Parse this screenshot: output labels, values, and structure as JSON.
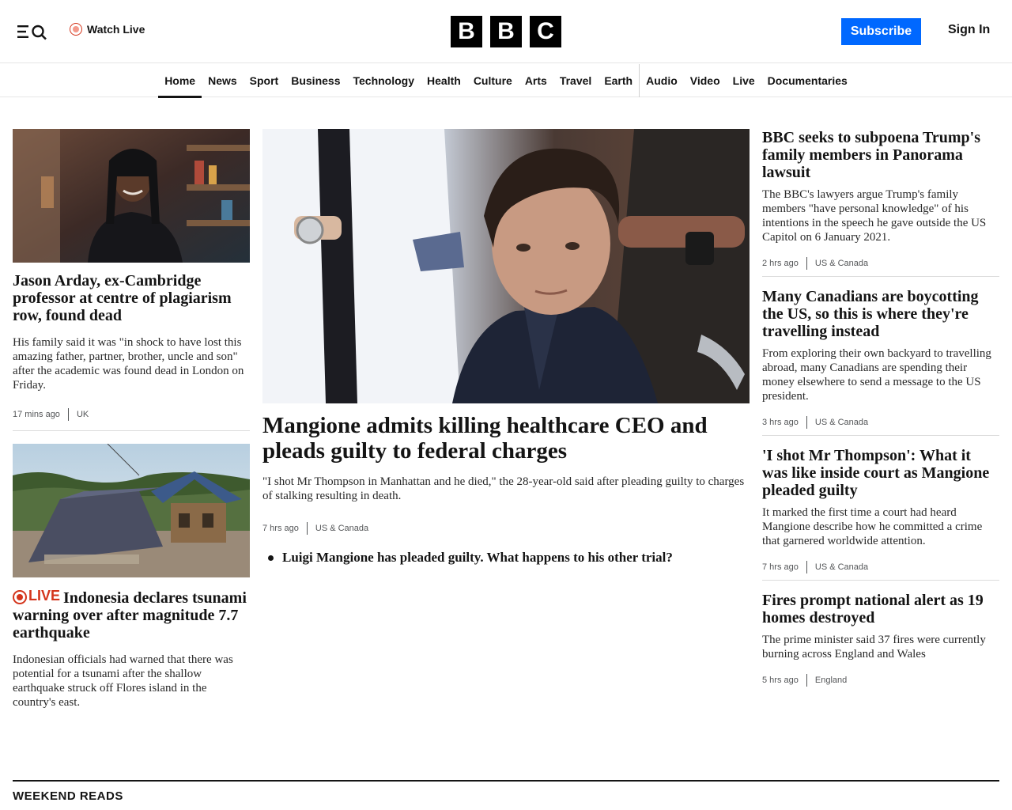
{
  "header": {
    "watch_live": "Watch Live",
    "logo_letters": [
      "B",
      "B",
      "C"
    ],
    "subscribe": "Subscribe",
    "sign_in": "Sign In"
  },
  "nav": {
    "items": [
      "Home",
      "News",
      "Sport",
      "Business",
      "Technology",
      "Health",
      "Culture",
      "Arts",
      "Travel",
      "Earth",
      "Audio",
      "Video",
      "Live",
      "Documentaries"
    ],
    "active": "Home"
  },
  "left": {
    "story1": {
      "headline": "Jason Arday, ex-Cambridge professor at centre of plagiarism row, found dead",
      "summary": "His family said it was \"in shock to have lost this amazing father, partner, brother, uncle and son\" after the academic was found dead in London on Friday.",
      "time": "17 mins ago",
      "category": "UK"
    },
    "story2": {
      "live_label": "LIVE",
      "headline": "Indonesia declares tsunami warning over after magnitude 7.7 earthquake",
      "summary": "Indonesian officials had warned that there was potential for a tsunami after the shallow earthquake struck off Flores island in the country's east."
    }
  },
  "center": {
    "headline": "Mangione admits killing healthcare CEO and pleads guilty to federal charges",
    "summary": "\"I shot Mr Thompson in Manhattan and he died,\" the 28-year-old said after pleading guilty to charges of stalking resulting in death.",
    "time": "7 hrs ago",
    "category": "US & Canada",
    "related": "Luigi Mangione has pleaded guilty. What happens to his other trial?"
  },
  "right": {
    "stories": [
      {
        "headline": "BBC seeks to subpoena Trump's family members in Panorama lawsuit",
        "summary": "The BBC's lawyers argue Trump's family members \"have personal knowledge\" of his intentions in the speech he gave outside the US Capitol on 6 January 2021.",
        "time": "2 hrs ago",
        "category": "US & Canada"
      },
      {
        "headline": "Many Canadians are boycotting the US, so this is where they're travelling instead",
        "summary": "From exploring their own backyard to travelling abroad, many Canadians are spending their money elsewhere to send a message to the US president.",
        "time": "3 hrs ago",
        "category": "US & Canada"
      },
      {
        "headline": "'I shot Mr Thompson': What it was like inside court as Mangione pleaded guilty",
        "summary": "It marked the first time a court had heard Mangione describe how he committed a crime that garnered worldwide attention.",
        "time": "7 hrs ago",
        "category": "US & Canada"
      },
      {
        "headline": "Fires prompt national alert as 19 homes destroyed",
        "summary": "The prime minister said 37 fires were currently burning across England and Wales",
        "time": "5 hrs ago",
        "category": "England"
      }
    ]
  },
  "sections": {
    "weekend_reads": "WEEKEND READS"
  },
  "colors": {
    "accent_blue": "#0068ff",
    "live_red": "#d4351c",
    "text": "#141414"
  },
  "icons": {
    "menu": "menu-search-icon",
    "live": "live-dot-icon"
  }
}
